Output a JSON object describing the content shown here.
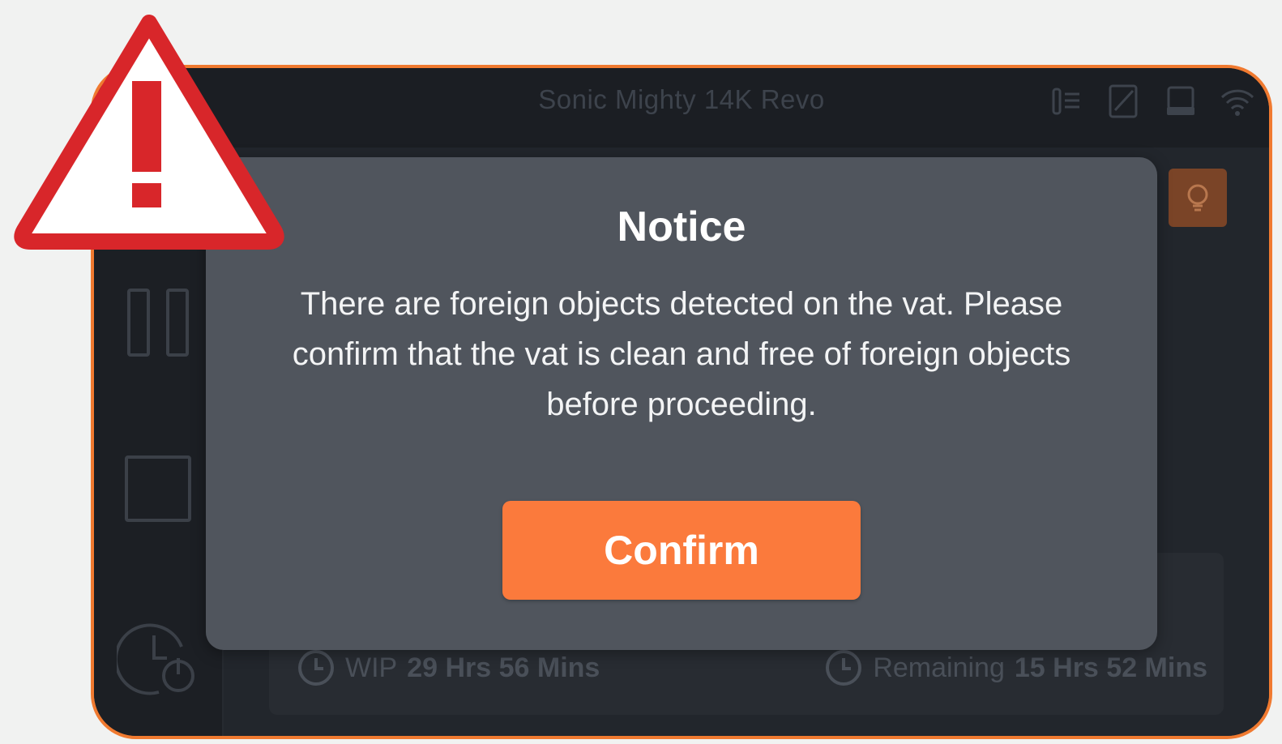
{
  "device": {
    "title": "Sonic Mighty 14K Revo",
    "status_icons": [
      "resin-level-icon",
      "plate-icon",
      "printer-icon",
      "wifi-icon"
    ],
    "accent_color": "#f07a30"
  },
  "sidebar": {
    "buttons": [
      "pause-icon",
      "stop-icon",
      "timer-power-icon"
    ]
  },
  "main": {
    "light_button_icon": "bulb-icon",
    "stats": {
      "wip_label": "WIP",
      "wip_value": "29 Hrs 56 Mins",
      "remaining_label": "Remaining",
      "remaining_value": "15 Hrs 52 Mins"
    }
  },
  "modal": {
    "title": "Notice",
    "message": "There are foreign objects detected on the vat. Please confirm that the vat is clean and free of foreign objects before proceeding.",
    "confirm_label": "Confirm",
    "confirm_color": "#fb7a3c"
  },
  "warning_overlay": {
    "icon": "warning-triangle-icon",
    "color": "#d8262a"
  }
}
